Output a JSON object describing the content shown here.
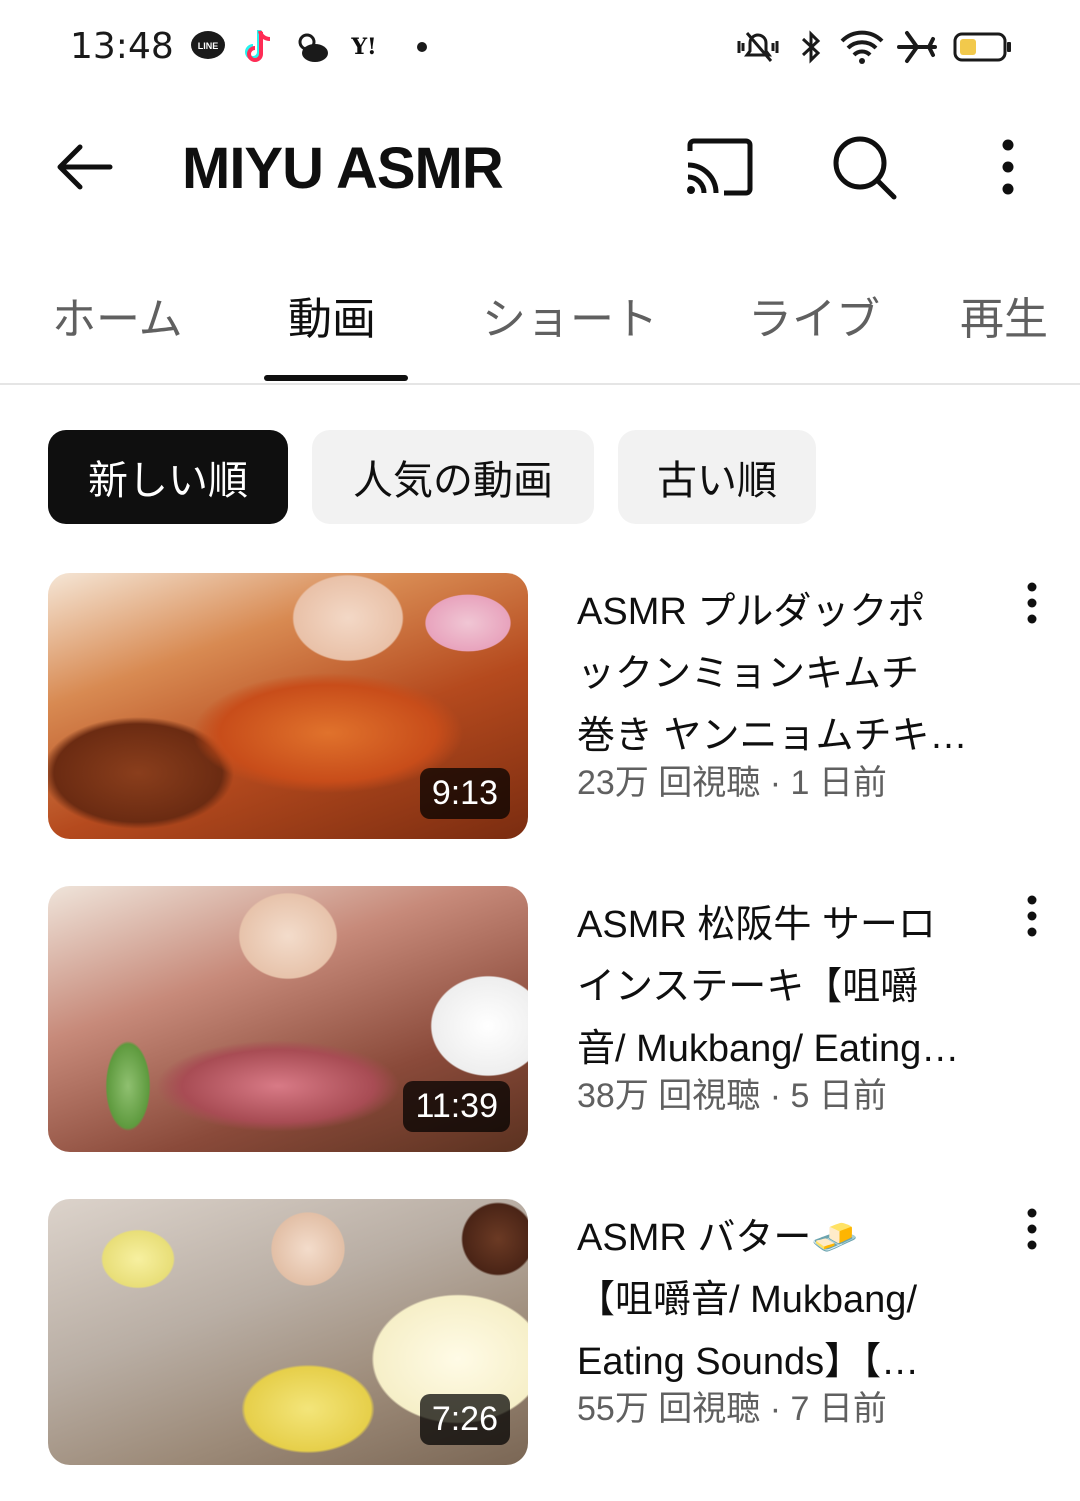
{
  "status_bar": {
    "time": "13:48",
    "notification_icons": [
      "line-icon",
      "tiktok-icon",
      "weather-icon",
      "yahoo-icon",
      "dot-icon"
    ],
    "system_icons": [
      "vibrate-icon",
      "bluetooth-icon",
      "wifi-icon",
      "airplane-icon",
      "battery-icon"
    ],
    "line_label": "LINE",
    "yahoo_label": "Y!"
  },
  "app_bar": {
    "title": "MIYU ASMR"
  },
  "tabs": [
    {
      "label": "ホーム",
      "active": false
    },
    {
      "label": "動画",
      "active": true
    },
    {
      "label": "ショート",
      "active": false
    },
    {
      "label": "ライブ",
      "active": false
    },
    {
      "label": "再生",
      "active": false
    }
  ],
  "chips": [
    {
      "label": "新しい順",
      "selected": true
    },
    {
      "label": "人気の動画",
      "selected": false
    },
    {
      "label": "古い順",
      "selected": false
    }
  ],
  "videos": [
    {
      "title_lines": [
        "ASMR プルダックポ",
        "ックンミョンキムチ",
        "巻き ヤンニョムチキ…"
      ],
      "meta": "23万 回視聴 · 1 日前",
      "duration": "9:13"
    },
    {
      "title_lines": [
        "ASMR 松阪牛 サーロ",
        "インステーキ【咀嚼",
        "音/ Mukbang/ Eating…"
      ],
      "meta": "38万 回視聴 · 5 日前",
      "duration": "11:39"
    },
    {
      "title_lines": [
        "ASMR バター🧈",
        "【咀嚼音/ Mukbang/",
        "Eating Sounds】【…"
      ],
      "meta": "55万 回視聴 · 7 日前",
      "duration": "7:26"
    }
  ]
}
